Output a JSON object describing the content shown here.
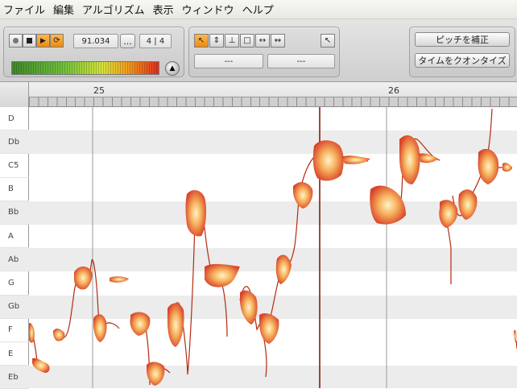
{
  "menu": [
    "ファイル",
    "編集",
    "アルゴリズム",
    "表示",
    "ウィンドウ",
    "ヘルプ"
  ],
  "transport": {
    "time": "91.034",
    "dots": "...",
    "signature": "4 | 4",
    "buttons": [
      "record-icon",
      "stop-icon",
      "play-icon",
      "loop-icon"
    ]
  },
  "tools": {
    "items": [
      "arrow-tool-icon",
      "pitch-tool-icon",
      "formant-tool-icon",
      "amplitude-tool-icon",
      "timing-tool-icon",
      "separation-tool-icon"
    ],
    "field1": "---",
    "field2": "---",
    "extra": "scroll-zoom-tool-icon"
  },
  "actions": {
    "pitch_correct": "ピッチを補正",
    "quantize_time": "タイムをクオンタイズ"
  },
  "ruler": {
    "markers": [
      "25",
      "26"
    ]
  },
  "keys": [
    "D",
    "Db",
    "C5",
    "B",
    "Bb",
    "A",
    "Ab",
    "G",
    "Gb",
    "F",
    "E",
    "Eb"
  ],
  "colors": {
    "blob_outer": "#d8442a",
    "blob_mid": "#f7b25e",
    "blob_inner": "#fff4c8",
    "pitch_line": "#b32b10"
  }
}
